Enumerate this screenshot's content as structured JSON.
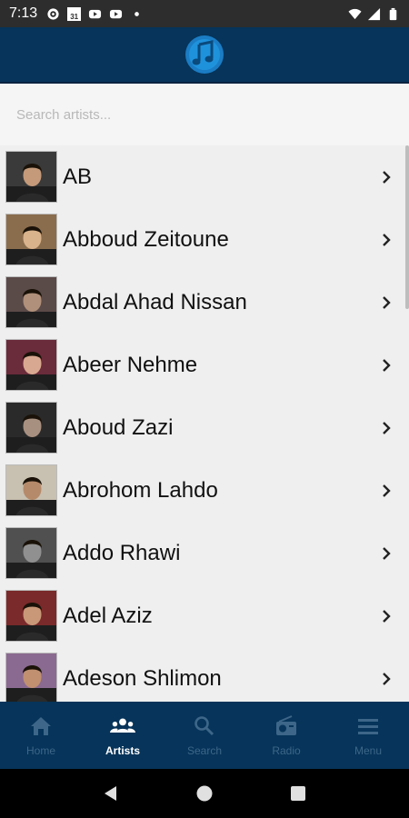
{
  "status_bar": {
    "time": "7:13",
    "icons_left": [
      "gear-icon",
      "calendar-icon",
      "youtube-icon",
      "youtube-icon",
      "dot-icon"
    ],
    "calendar_day": "31",
    "icons_right": [
      "wifi-icon",
      "signal-icon",
      "battery-icon"
    ]
  },
  "header": {
    "logo": "music-note-logo"
  },
  "search": {
    "placeholder": "Search artists...",
    "value": ""
  },
  "artists": [
    {
      "name": "AB",
      "photo_colors": [
        "#3a3a3a",
        "#c49a7a"
      ]
    },
    {
      "name": "Abboud Zeitoune",
      "photo_colors": [
        "#8a6d4d",
        "#d9b38c"
      ]
    },
    {
      "name": "Abdal Ahad Nissan",
      "photo_colors": [
        "#5a4a48",
        "#b0907a"
      ]
    },
    {
      "name": "Abeer Nehme",
      "photo_colors": [
        "#6a2b3a",
        "#d8a890"
      ]
    },
    {
      "name": "Aboud Zazi",
      "photo_colors": [
        "#2a2a2a",
        "#a89080"
      ]
    },
    {
      "name": "Abrohom Lahdo",
      "photo_colors": [
        "#c8c0b0",
        "#b58a6a"
      ]
    },
    {
      "name": "Addo Rhawi",
      "photo_colors": [
        "#505050",
        "#909090"
      ]
    },
    {
      "name": "Adel Aziz",
      "photo_colors": [
        "#7a2a2a",
        "#c89878"
      ]
    },
    {
      "name": "Adeson Shlimon",
      "photo_colors": [
        "#8a6a90",
        "#c09070"
      ]
    }
  ],
  "bottom_nav": [
    {
      "label": "Home",
      "icon": "home-icon",
      "active": false
    },
    {
      "label": "Artists",
      "icon": "people-icon",
      "active": true
    },
    {
      "label": "Search",
      "icon": "search-icon",
      "active": false
    },
    {
      "label": "Radio",
      "icon": "radio-icon",
      "active": false
    },
    {
      "label": "Menu",
      "icon": "menu-icon",
      "active": false
    }
  ],
  "system_nav": [
    "back-icon",
    "home-circle-icon",
    "recents-icon"
  ],
  "colors": {
    "header_bg": "#06345a",
    "list_bg": "#efefef",
    "nav_inactive": "#3d6688",
    "nav_active": "#ffffff"
  }
}
